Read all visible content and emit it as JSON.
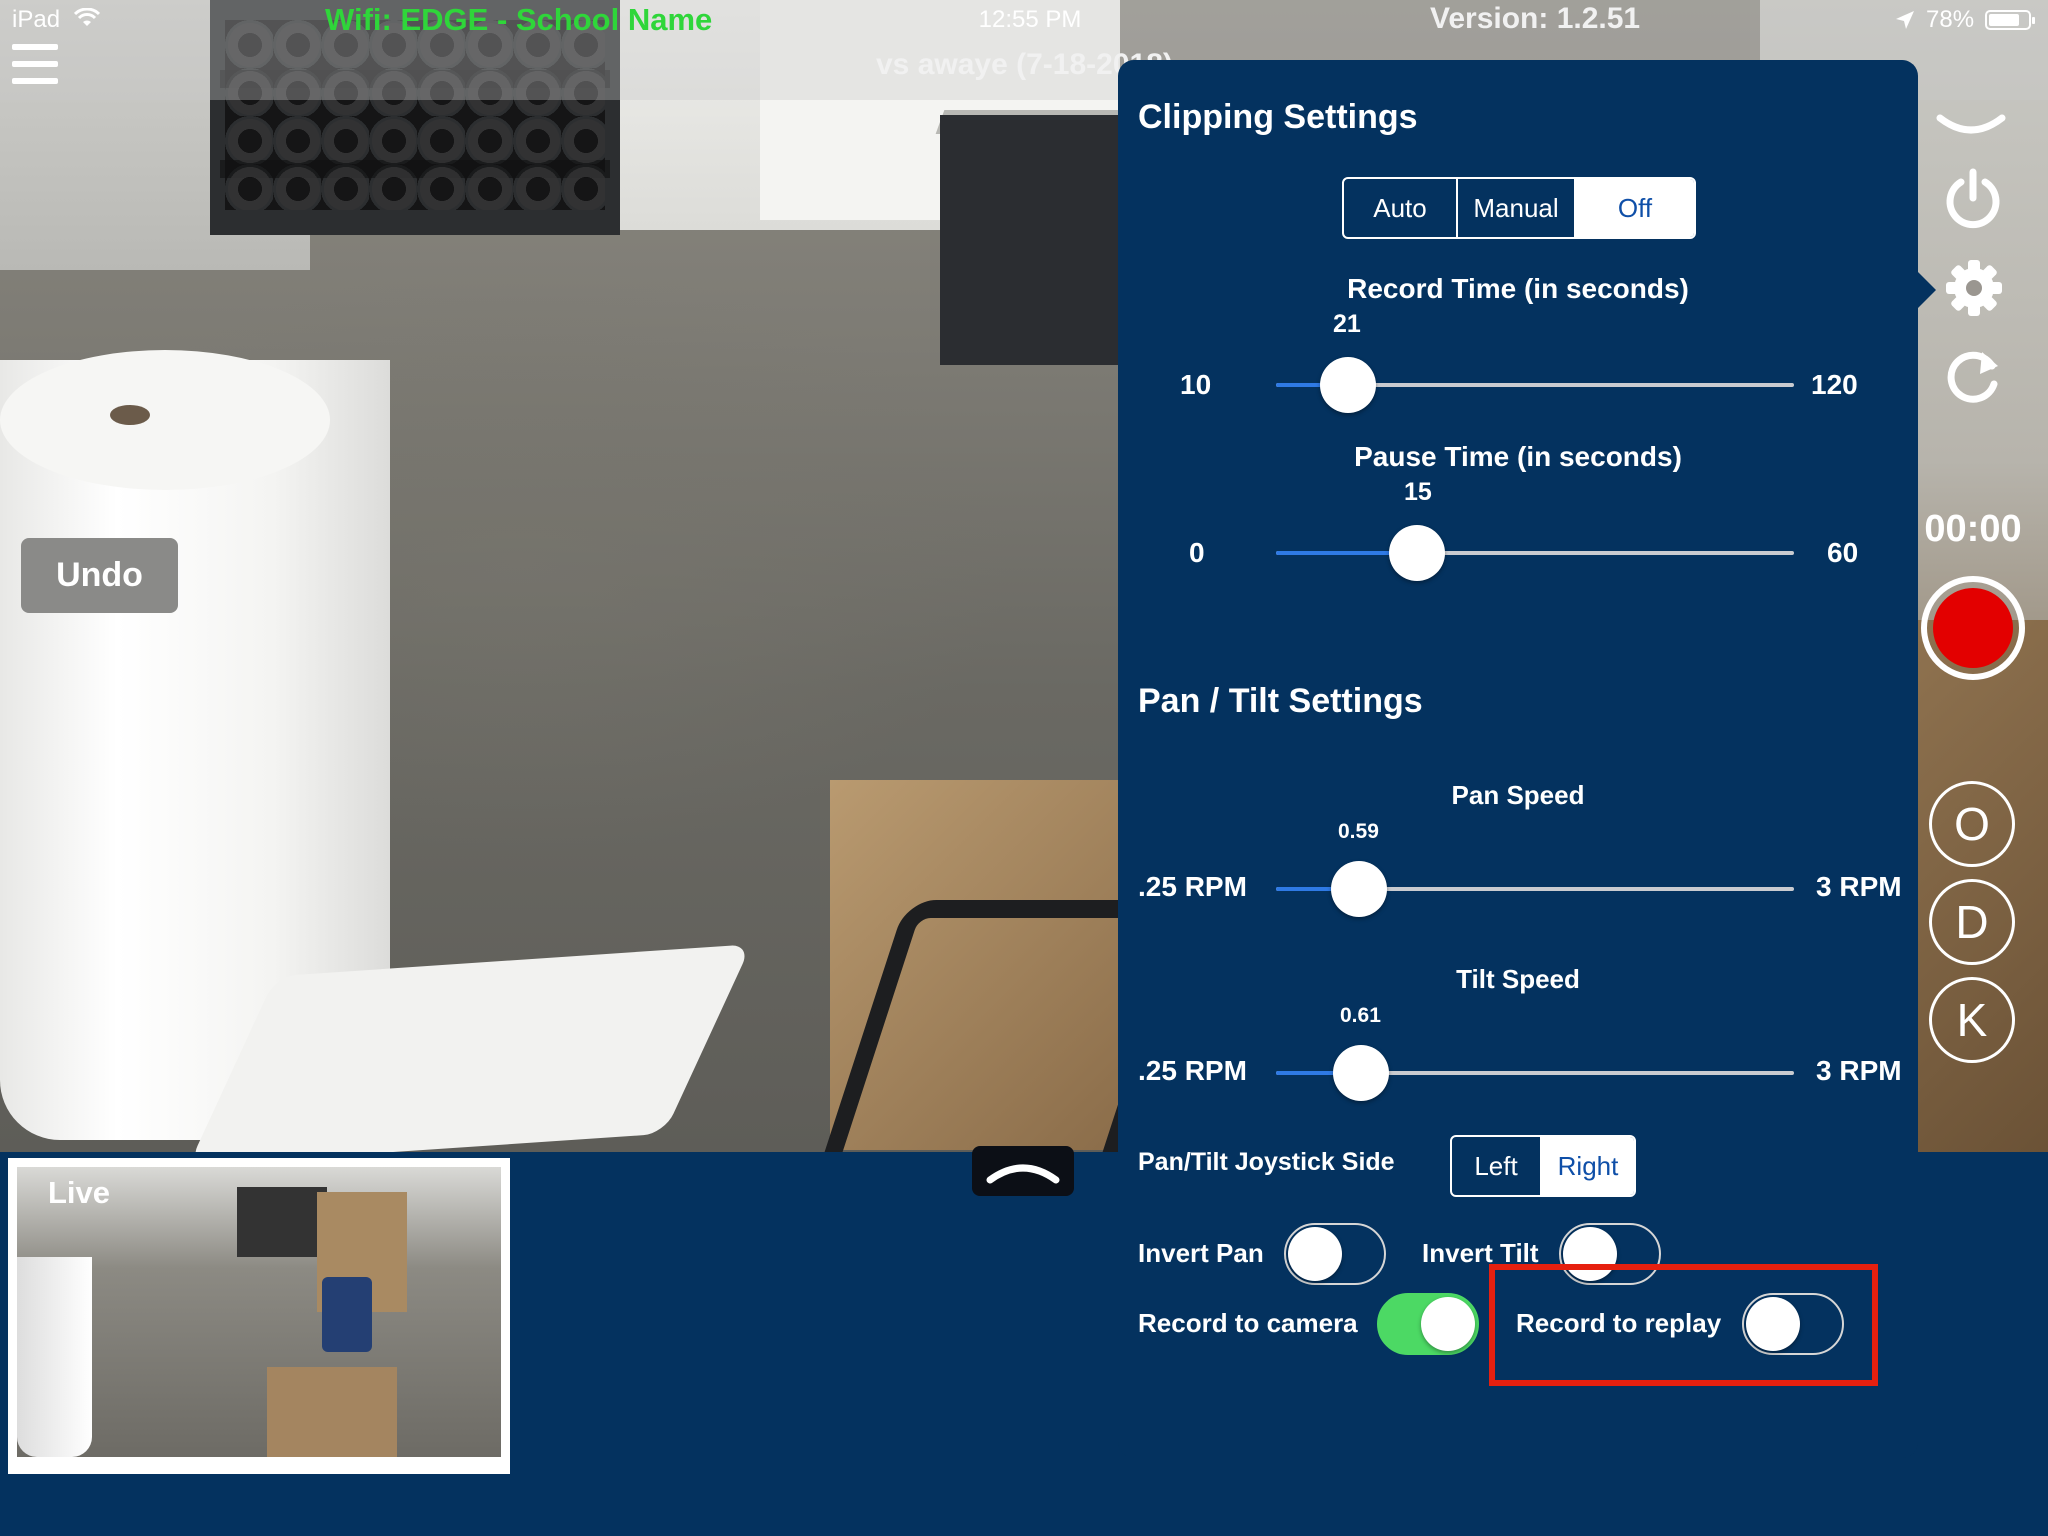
{
  "status_bar": {
    "device": "iPad",
    "title": "Wifi: EDGE - School Name",
    "time": "12:55 PM",
    "version": "Version: 1.2.51",
    "subtitle": "vs awaye (7-18-2018)",
    "battery": "78%"
  },
  "controls": {
    "undo_label": "Undo",
    "timer": "00:00",
    "letter_buttons": [
      "O",
      "D",
      "K"
    ],
    "record_color": "#e30000"
  },
  "preview": {
    "label": "Live"
  },
  "clipping": {
    "title": "Clipping Settings",
    "mode_options": [
      "Auto",
      "Manual",
      "Off"
    ],
    "mode_selected": "Off",
    "record_time": {
      "label": "Record Time (in seconds)",
      "value": "21",
      "min": "10",
      "max": "120"
    },
    "pause_time": {
      "label": "Pause Time (in seconds)",
      "value": "15",
      "min": "0",
      "max": "60"
    }
  },
  "pan_tilt": {
    "title": "Pan / Tilt Settings",
    "pan_speed": {
      "label": "Pan Speed",
      "value": "0.59",
      "min": ".25 RPM",
      "max": "3 RPM"
    },
    "tilt_speed": {
      "label": "Tilt Speed",
      "value": "0.61",
      "min": ".25 RPM",
      "max": "3 RPM"
    },
    "joystick_label": "Pan/Tilt Joystick Side",
    "joystick_options": [
      "Left",
      "Right"
    ],
    "joystick_selected": "Right",
    "invert_pan_label": "Invert Pan",
    "invert_pan": false,
    "invert_tilt_label": "Invert Tilt",
    "invert_tilt": false,
    "record_camera_label": "Record to camera",
    "record_camera": true,
    "record_replay_label": "Record to replay",
    "record_replay": false
  },
  "colors": {
    "panel_bg": "#04325f",
    "accent_blue": "#2f7ae5",
    "toggle_on": "#4cd964",
    "wifi_title": "#2fd63a",
    "highlight": "#e6200f"
  }
}
